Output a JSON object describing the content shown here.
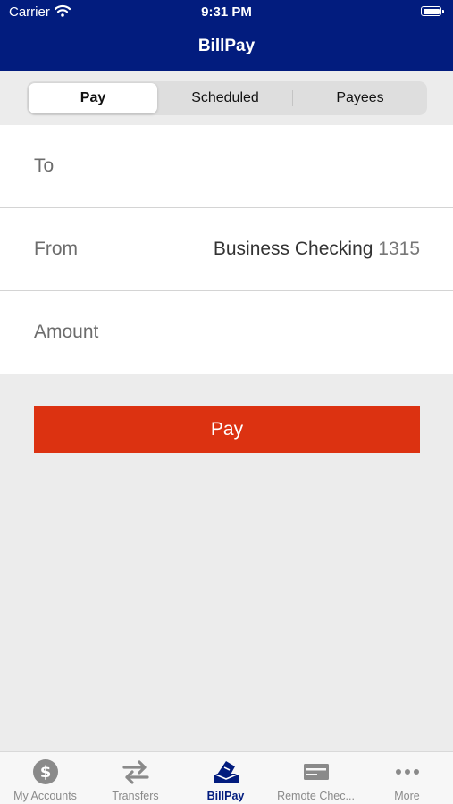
{
  "status_bar": {
    "carrier": "Carrier",
    "time": "9:31 PM"
  },
  "nav": {
    "title": "BillPay"
  },
  "segments": [
    {
      "label": "Pay",
      "active": true
    },
    {
      "label": "Scheduled",
      "active": false
    },
    {
      "label": "Payees",
      "active": false
    }
  ],
  "form": {
    "to_label": "To",
    "from_label": "From",
    "from_account_name": "Business Checking",
    "from_account_number": "1315",
    "amount_label": "Amount"
  },
  "pay_button": "Pay",
  "tabs": [
    {
      "label": "My Accounts",
      "icon": "dollar-circle-icon"
    },
    {
      "label": "Transfers",
      "icon": "transfer-arrows-icon"
    },
    {
      "label": "BillPay",
      "icon": "billpay-icon",
      "active": true
    },
    {
      "label": "Remote Chec...",
      "icon": "check-icon"
    },
    {
      "label": "More",
      "icon": "more-dots-icon"
    }
  ],
  "colors": {
    "header": "#021c7e",
    "pay_button": "#dc3211",
    "background": "#ececec",
    "active_tab": "#021c7e"
  }
}
